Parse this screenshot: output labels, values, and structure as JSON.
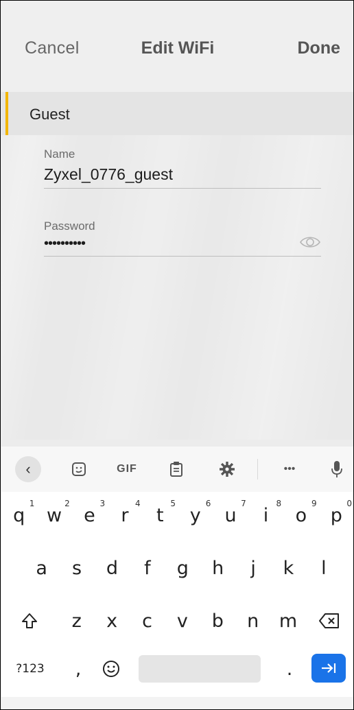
{
  "header": {
    "cancel_label": "Cancel",
    "title": "Edit WiFi",
    "done_label": "Done"
  },
  "section": {
    "label": "Guest",
    "accent_color": "#f2b600"
  },
  "fields": {
    "name": {
      "label": "Name",
      "value": "Zyxel_0776_guest"
    },
    "password": {
      "label": "Password",
      "value": "••••••••••",
      "icon": "eye-icon"
    }
  },
  "keyboard": {
    "toolbar": {
      "back_icon": "chevron-left-icon",
      "sticker_icon": "sticker-icon",
      "gif_label": "GIF",
      "clipboard_icon": "clipboard-icon",
      "settings_icon": "gear-icon",
      "more_label": "•••",
      "mic_icon": "microphone-icon"
    },
    "row1": [
      {
        "k": "q",
        "n": "1"
      },
      {
        "k": "w",
        "n": "2"
      },
      {
        "k": "e",
        "n": "3"
      },
      {
        "k": "r",
        "n": "4"
      },
      {
        "k": "t",
        "n": "5"
      },
      {
        "k": "y",
        "n": "6"
      },
      {
        "k": "u",
        "n": "7"
      },
      {
        "k": "i",
        "n": "8"
      },
      {
        "k": "o",
        "n": "9"
      },
      {
        "k": "p",
        "n": "0"
      }
    ],
    "row2": [
      "a",
      "s",
      "d",
      "f",
      "g",
      "h",
      "j",
      "k",
      "l"
    ],
    "row3": [
      "z",
      "x",
      "c",
      "v",
      "b",
      "n",
      "m"
    ],
    "row4": {
      "symbols_label": "?123",
      "comma_label": ",",
      "emoji_icon": "emoji-icon",
      "period_label": ".",
      "enter_icon": "tab-arrow-icon",
      "enter_color": "#1a73e8"
    }
  }
}
